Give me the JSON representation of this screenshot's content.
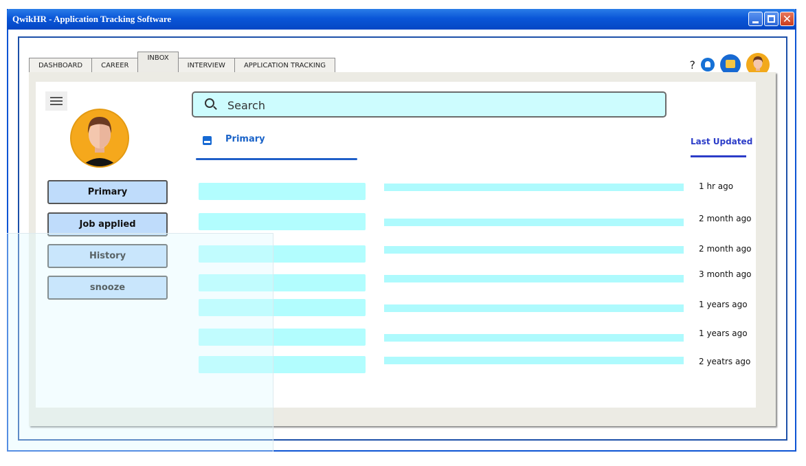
{
  "window": {
    "title": "QwikHR - Application Tracking Software",
    "controls": [
      "minimize-icon",
      "maximize-icon",
      "close-icon"
    ]
  },
  "tabs": [
    {
      "label": "DASHBOARD"
    },
    {
      "label": "CAREER"
    },
    {
      "label": "INBOX",
      "active": true
    },
    {
      "label": "INTERVIEW"
    },
    {
      "label": "APPLICATION TRACKING"
    }
  ],
  "header_icons": {
    "help": "?",
    "items": [
      "help-icon",
      "notification-bell-icon",
      "chat-icon",
      "user-avatar"
    ]
  },
  "sidebar": {
    "items": [
      {
        "label": "Primary"
      },
      {
        "label": "Job applied"
      },
      {
        "label": "History"
      },
      {
        "label": "snooze"
      }
    ]
  },
  "search": {
    "placeholder": "Search",
    "value": ""
  },
  "inbox": {
    "tab_label": "Primary",
    "sort_label": "Last Updated",
    "rows": [
      {
        "time": "1 hr ago"
      },
      {
        "time": "2 month ago"
      },
      {
        "time": "2 month ago"
      },
      {
        "time": "3 month ago"
      },
      {
        "time": "1 years ago"
      },
      {
        "time": "1 years ago"
      },
      {
        "time": "2 yeatrs ago"
      }
    ]
  },
  "colors": {
    "titlebar": "#0a56d8",
    "accent": "#1a63c8",
    "row_fill": "#b2fdfe",
    "sidebar_button": "#bfdcfb",
    "avatar_bg": "#f5a81c"
  }
}
